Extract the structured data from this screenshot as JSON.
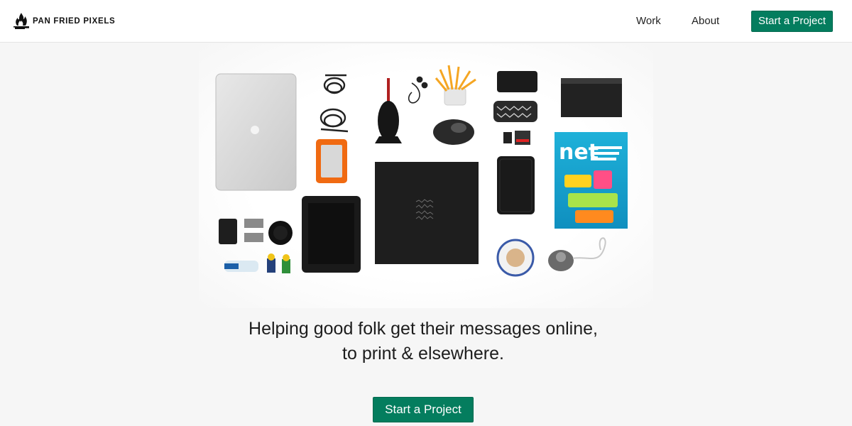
{
  "header": {
    "brand_name": "PAN FRIED PIXELS",
    "logo_icon": "flame-pan-icon",
    "nav": [
      {
        "label": "Work"
      },
      {
        "label": "About"
      }
    ],
    "cta_label": "Start a Project"
  },
  "hero": {
    "image_subject": "knolling-desk-flatlay",
    "magazine_title": "net",
    "tagline_line1": "Helping good folk get their messages online,",
    "tagline_line2": "to print & elsewhere.",
    "cta_label": "Start a Project"
  },
  "colors": {
    "accent": "#047d5e",
    "background": "#f6f6f6",
    "header_background": "#ffffff"
  }
}
